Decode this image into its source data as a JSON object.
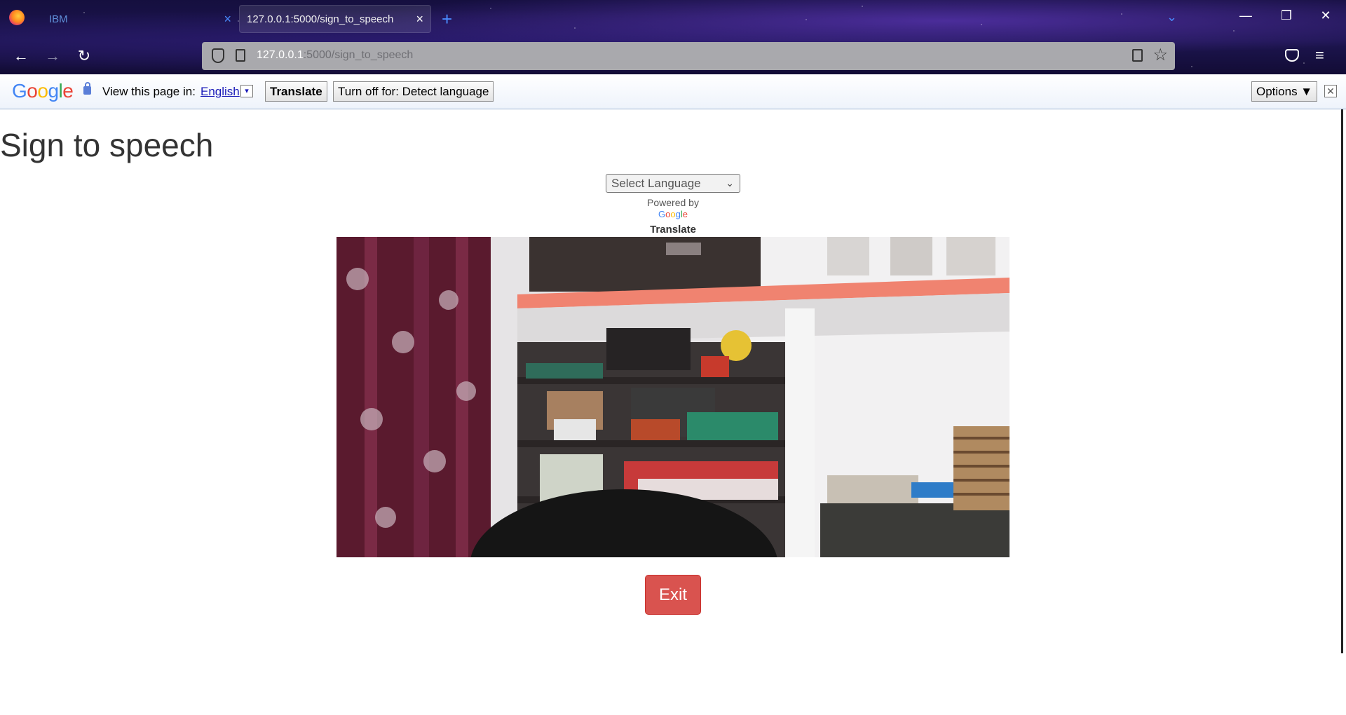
{
  "browser": {
    "tabs": [
      {
        "label": "IBM",
        "active": false,
        "close_icon": "×"
      },
      {
        "label": "127.0.0.1:5000/sign_to_speech",
        "active": true,
        "close_icon": "×"
      }
    ],
    "new_tab_icon": "+",
    "tab_list_icon": "⌄",
    "window": {
      "minimize": "—",
      "maximize": "❐",
      "close": "✕"
    },
    "nav": {
      "back": "←",
      "forward": "→",
      "reload": "↻",
      "menu": "≡"
    },
    "url": {
      "host": "127.0.0.1",
      "rest": ":5000/sign_to_speech"
    },
    "star_icon": "☆"
  },
  "translate_bar": {
    "logo": [
      "G",
      "o",
      "o",
      "g",
      "l",
      "e"
    ],
    "label": "View this page in:",
    "language": "English",
    "language_dropdown": "▾",
    "translate_button": "Translate",
    "turn_off_button": "Turn off for: Detect language",
    "options_button": "Options ▼",
    "close_icon": "✕"
  },
  "page": {
    "title": "Sign to speech",
    "language_select": {
      "value": "Select Language",
      "caret": "⌄"
    },
    "powered_by": "Powered by",
    "powered_google": [
      "G",
      "o",
      "o",
      "g",
      "l",
      "e"
    ],
    "powered_translate": "Translate",
    "exit_button": "Exit"
  },
  "colors": {
    "exit_button": "#d9534f",
    "chrome_background": "#1a1448",
    "url_bar": "#a9a9ad"
  }
}
